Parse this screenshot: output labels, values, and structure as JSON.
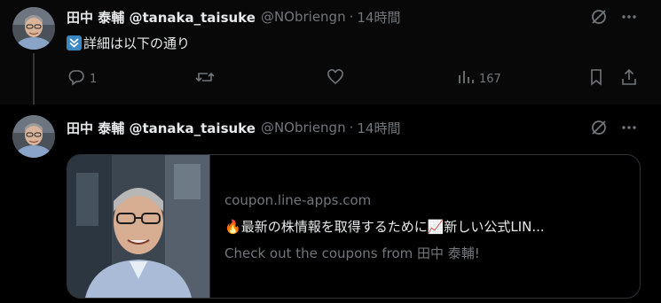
{
  "tweets": [
    {
      "display_name": "田中 泰輔 @tanaka_taisuke",
      "handle": "@NObriengn",
      "separator": "·",
      "time": "14時間",
      "emoji": "arrow-double-down-emoji",
      "text": "詳細は以下の通り",
      "actions": {
        "reply_count": "1",
        "retweet_count": "",
        "like_count": "",
        "views_count": "167"
      }
    },
    {
      "display_name": "田中 泰輔 @tanaka_taisuke",
      "handle": "@NObriengn",
      "separator": "·",
      "time": "14時間",
      "card": {
        "domain": "coupon.line-apps.com",
        "title_prefix_emoji": "🔥",
        "title_part1": "最新の株情報を取得するために",
        "title_mid_emoji": "📈",
        "title_part2": "新しい公式LIN...",
        "description": "Check out the coupons from 田中 泰輔!"
      }
    }
  ],
  "icons": {
    "grok": "grok-icon",
    "more": "more-icon",
    "reply": "reply-icon",
    "retweet": "retweet-icon",
    "like": "like-icon",
    "views": "views-icon",
    "bookmark": "bookmark-icon",
    "share": "share-icon"
  },
  "colors": {
    "background": "#000000",
    "text_primary": "#e7e9ea",
    "text_secondary": "#71767b",
    "border": "#2f3336"
  }
}
